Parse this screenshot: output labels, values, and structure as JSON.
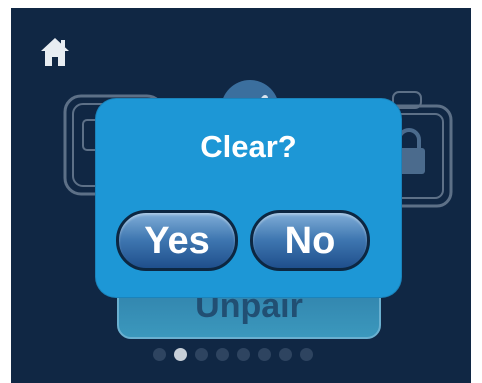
{
  "dialog": {
    "title": "Clear?",
    "yes_label": "Yes",
    "no_label": "No"
  },
  "background": {
    "unpair_label": "Unpair"
  },
  "pager": {
    "total": 8,
    "active_index": 1
  },
  "icons": {
    "home": "home-icon",
    "check": "checkmark-icon",
    "lock": "lock-icon"
  },
  "colors": {
    "screen": "#102744",
    "dialog": "#1d97d6",
    "button": "#3f77b1"
  }
}
